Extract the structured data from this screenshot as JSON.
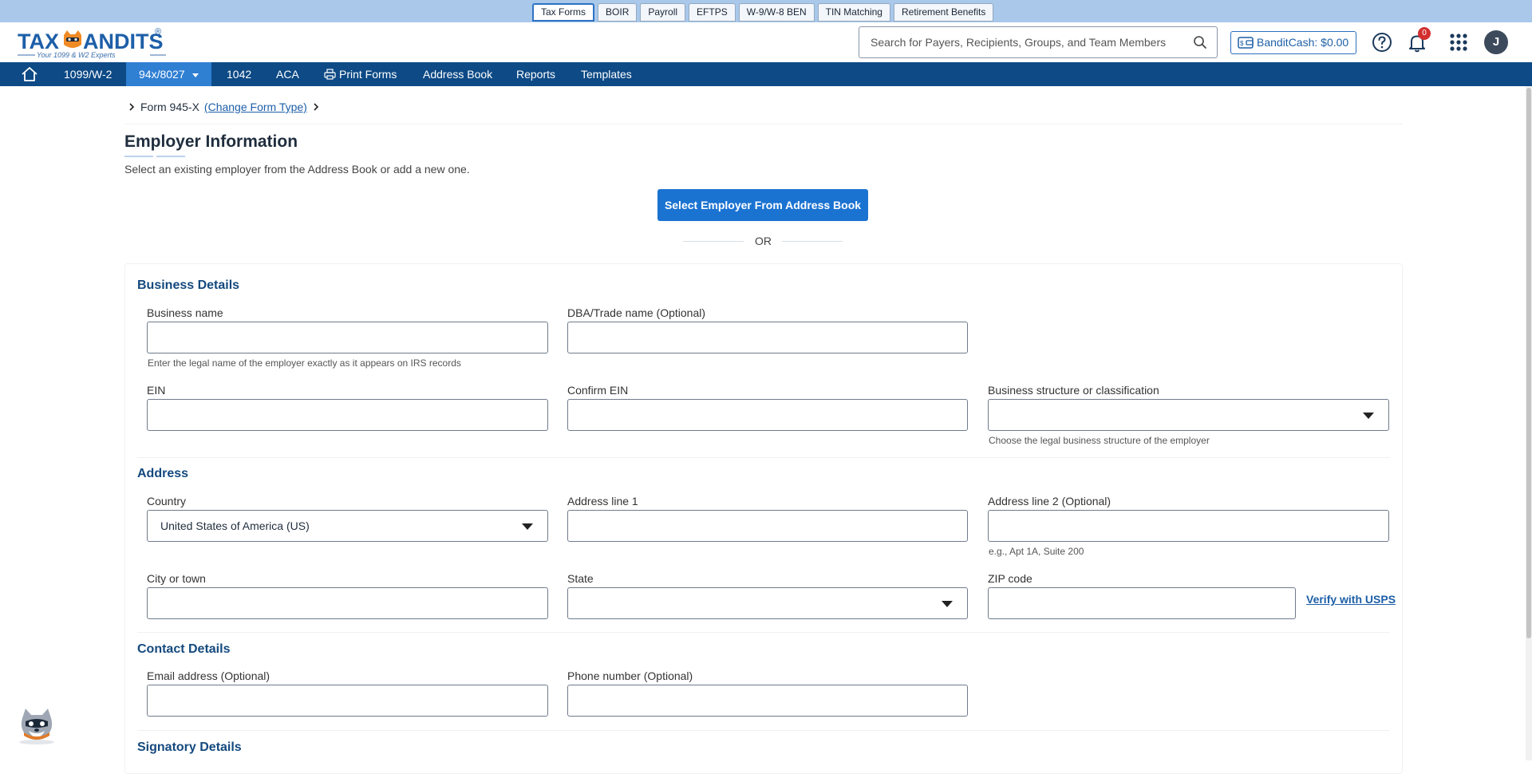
{
  "top_tabs": [
    {
      "label": "Tax Forms",
      "active": true
    },
    {
      "label": "BOIR"
    },
    {
      "label": "Payroll"
    },
    {
      "label": "EFTPS"
    },
    {
      "label": "W-9/W-8 BEN"
    },
    {
      "label": "TIN Matching"
    },
    {
      "label": "Retirement Benefits"
    }
  ],
  "header": {
    "logo_text": "TAXBANDITS",
    "logo_tagline": "Your 1099 & W2 Experts",
    "search_placeholder": "Search for Payers, Recipients, Groups, and Team Members",
    "bandit_cash_label": "BanditCash: $0.00",
    "notification_count": "0",
    "avatar_initial": "J"
  },
  "nav": {
    "items": [
      "1099/W-2",
      "94x/8027",
      "1042",
      "ACA",
      "Print Forms",
      "Address Book",
      "Reports",
      "Templates"
    ]
  },
  "breadcrumb": {
    "form": "Form 945-X",
    "change_link": "(Change Form Type)"
  },
  "page": {
    "title": "Employer Information",
    "subtitle": "Select an existing employer from the Address Book or add a new one.",
    "select_button": "Select Employer From Address Book",
    "or_text": "OR"
  },
  "business_details": {
    "title": "Business Details",
    "business_name_label": "Business name",
    "business_name_value": "",
    "business_name_hint": "Enter the legal name of the employer exactly as it appears on IRS records",
    "dba_label": "DBA/Trade name (Optional)",
    "dba_value": "",
    "ein_label": "EIN",
    "ein_value": "",
    "confirm_ein_label": "Confirm EIN",
    "confirm_ein_value": "",
    "structure_label": "Business structure or classification",
    "structure_value": "",
    "structure_hint": "Choose the legal business structure of the employer"
  },
  "address": {
    "title": "Address",
    "country_label": "Country",
    "country_value": "United States of America (US)",
    "line1_label": "Address line 1",
    "line1_value": "",
    "line2_label": "Address line 2 (Optional)",
    "line2_value": "",
    "line2_hint": "e.g., Apt 1A, Suite 200",
    "city_label": "City or town",
    "city_value": "",
    "state_label": "State",
    "state_value": "",
    "zip_label": "ZIP code",
    "zip_value": "",
    "verify_link": "Verify with USPS"
  },
  "contact_details": {
    "title": "Contact Details",
    "email_label": "Email address (Optional)",
    "email_value": "",
    "phone_label": "Phone number (Optional)",
    "phone_value": ""
  },
  "signatory_details": {
    "title": "Signatory Details"
  },
  "colors": {
    "top_strip": "#a9c8ea",
    "nav_bar": "#0d4a86",
    "nav_active": "#2f7fd3",
    "primary_button": "#1b73d1",
    "section_title": "#14497e",
    "notification_badge": "#d32f2f"
  }
}
